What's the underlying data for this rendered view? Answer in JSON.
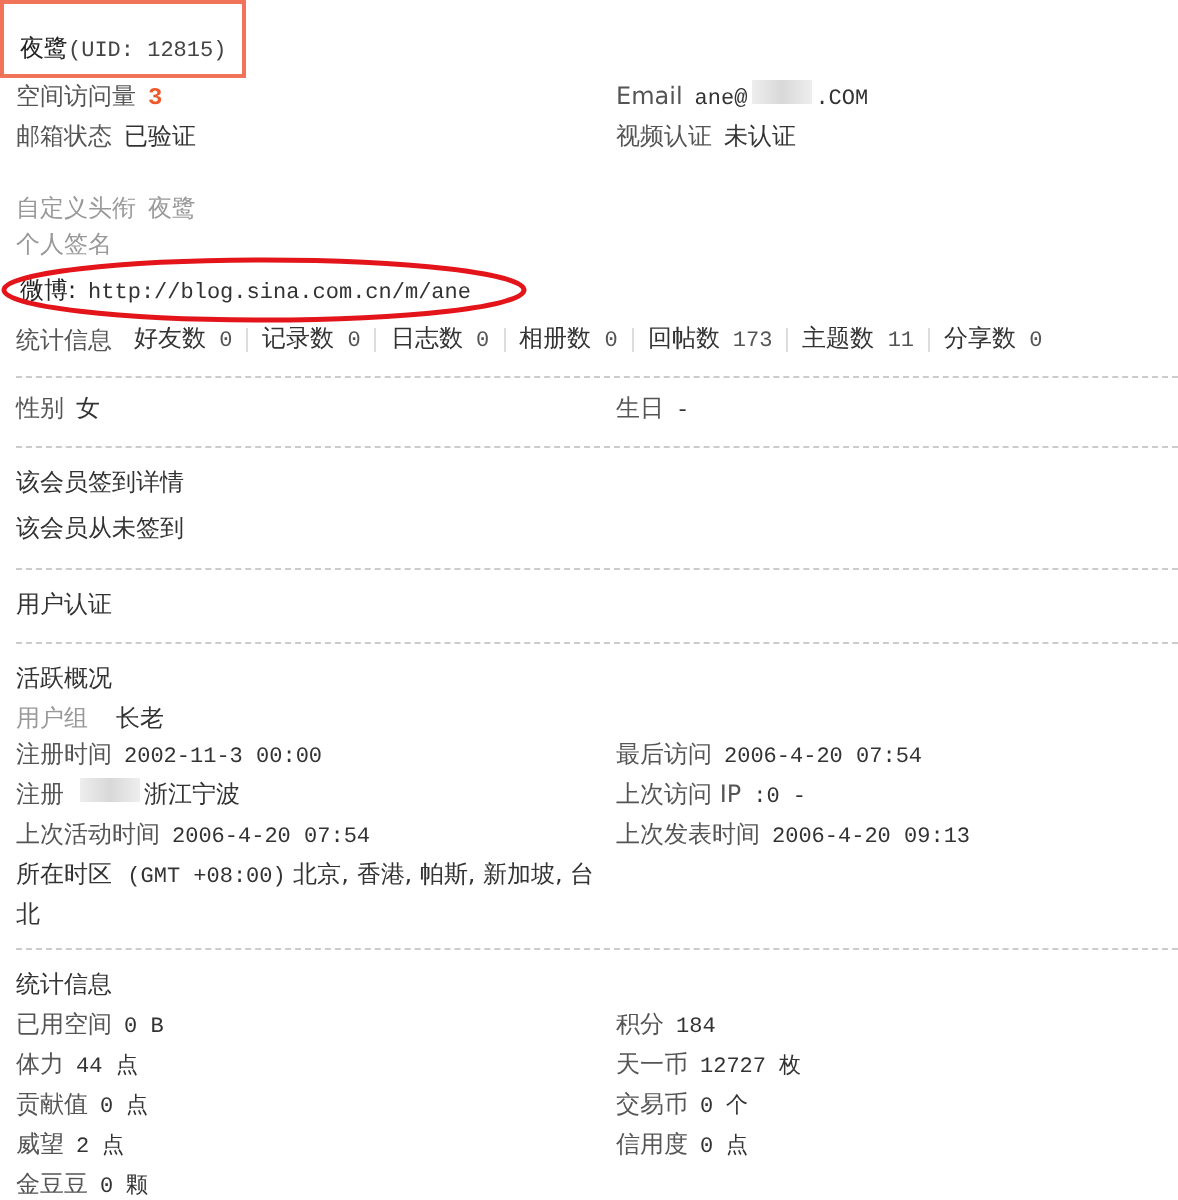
{
  "header": {
    "name": "夜鹭",
    "uid": "(UID: 12815)",
    "boxed": true
  },
  "sections": [
    {
      "rows": [
        {
          "kind": "pair",
          "cells": [
            {
              "kind": "count",
              "label": "空间访问量",
              "value": "3"
            },
            {
              "kind": "redacted",
              "label": "Email",
              "value": "ane@",
              "value_suffix": ".COM"
            }
          ]
        },
        {
          "kind": "pair",
          "cells": [
            {
              "kind": "plain",
              "label": "邮箱状态",
              "value": "已验证"
            },
            {
              "kind": "plain",
              "label": "视频认证",
              "value": "未认证"
            }
          ]
        },
        {
          "kind": "gap"
        },
        {
          "kind": "line",
          "cell": {
            "kind": "muted",
            "label": "自定义头衔",
            "value": "夜鹭"
          }
        },
        {
          "kind": "line",
          "cell": {
            "kind": "muted",
            "label": "个人签名"
          }
        },
        {
          "kind": "line",
          "circled": true,
          "cell": {
            "kind": "mono",
            "label": "微博:",
            "value": "http://blog.sina.com.cn/m/ane"
          }
        },
        {
          "kind": "stats",
          "label": "统计信息",
          "items": [
            {
              "label": "好友数",
              "value": "0"
            },
            {
              "label": "记录数",
              "value": "0"
            },
            {
              "label": "日志数",
              "value": "0"
            },
            {
              "label": "相册数",
              "value": "0"
            },
            {
              "label": "回帖数",
              "value": "173"
            },
            {
              "label": "主题数",
              "value": "11"
            },
            {
              "label": "分享数",
              "value": "0"
            }
          ]
        }
      ]
    },
    {
      "rows": [
        {
          "kind": "pair",
          "cells": [
            {
              "kind": "plain",
              "label": "性别",
              "value": "女"
            },
            {
              "kind": "plain",
              "label": "生日",
              "value": "-"
            }
          ]
        }
      ]
    },
    {
      "title": "该会员签到详情",
      "rows": [
        {
          "kind": "note",
          "text": "该会员从未签到"
        }
      ]
    },
    {
      "title": "用户认证"
    },
    {
      "title": "活跃概况",
      "rows": [
        {
          "kind": "line",
          "cell": {
            "kind": "group",
            "label": "用户组",
            "value": "长老"
          }
        },
        {
          "kind": "pair",
          "cells": [
            {
              "kind": "plain",
              "label": "注册时间",
              "value": "2002-11-3 00:00"
            },
            {
              "kind": "plain",
              "label": "最后访问",
              "value": "2006-4-20 07:54"
            }
          ]
        },
        {
          "kind": "pair",
          "cells": [
            {
              "kind": "redacted",
              "label": "注册",
              "value_suffix": "浙江宁波"
            },
            {
              "kind": "plain",
              "label": "上次访问 IP",
              "value": ":0 -"
            }
          ]
        },
        {
          "kind": "pair",
          "cells": [
            {
              "kind": "plain",
              "label": "上次活动时间",
              "value": "2006-4-20 07:54"
            },
            {
              "kind": "plain",
              "label": "上次发表时间",
              "value": "2006-4-20 09:13"
            }
          ]
        },
        {
          "kind": "pair",
          "cells": [
            {
              "kind": "zone",
              "label": "所在时区",
              "value": "(GMT +08:00)",
              "value_suffix": "北京, 香港, 帕斯, 新加坡, 台北"
            }
          ]
        }
      ]
    },
    {
      "title": "统计信息",
      "rows": [
        {
          "kind": "pair",
          "cells": [
            {
              "kind": "plain",
              "label": "已用空间",
              "value": "0 B"
            },
            {
              "kind": "plain",
              "label": "积分",
              "value": "184"
            }
          ]
        },
        {
          "kind": "pair",
          "cells": [
            {
              "kind": "plain",
              "label": "体力",
              "value": "44",
              "value_suffix": "点"
            },
            {
              "kind": "plain",
              "label": "天一币",
              "value": "12727",
              "value_suffix": "枚"
            }
          ]
        },
        {
          "kind": "pair",
          "cells": [
            {
              "kind": "plain",
              "label": "贡献值",
              "value": "0",
              "value_suffix": "点"
            },
            {
              "kind": "plain",
              "label": "交易币",
              "value": "0",
              "value_suffix": "个"
            }
          ]
        },
        {
          "kind": "pair",
          "cells": [
            {
              "kind": "plain",
              "label": "威望",
              "value": "2",
              "value_suffix": "点"
            },
            {
              "kind": "plain",
              "label": "信用度",
              "value": "0",
              "value_suffix": "点"
            }
          ]
        },
        {
          "kind": "pair",
          "cells": [
            {
              "kind": "plain",
              "label": "金豆豆",
              "value": "0",
              "value_suffix": "颗"
            }
          ]
        }
      ]
    }
  ]
}
